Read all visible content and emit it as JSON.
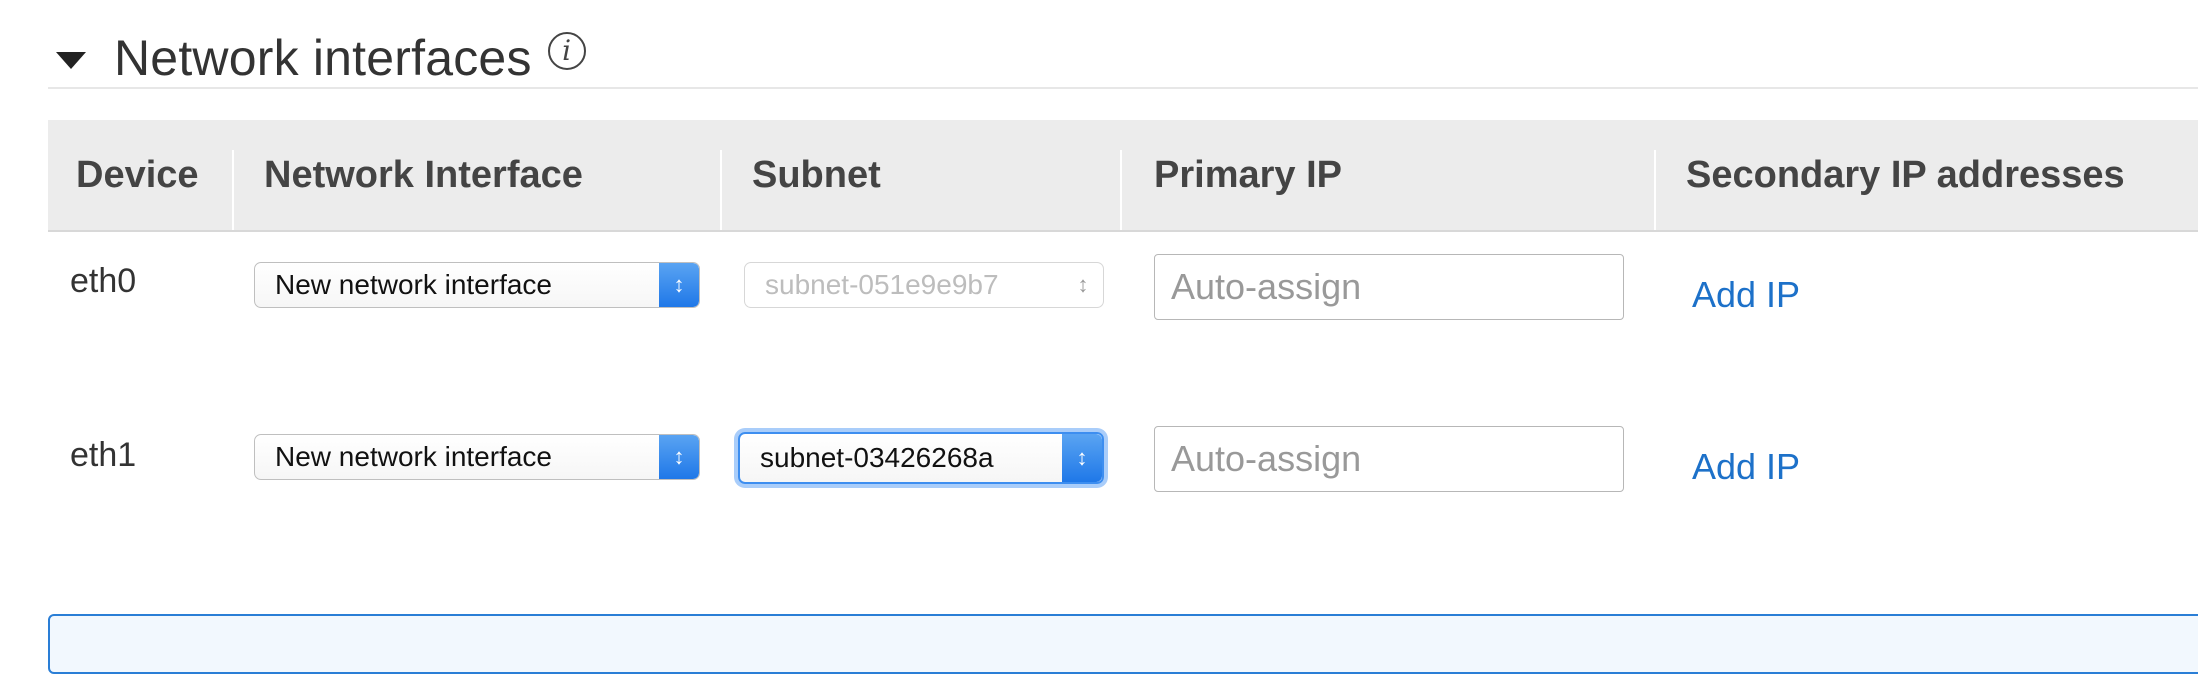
{
  "section": {
    "title": "Network interfaces",
    "info_glyph": "i",
    "toggle_icon": "caret-down-icon"
  },
  "table": {
    "columns": [
      "Device",
      "Network Interface",
      "Subnet",
      "Primary IP",
      "Secondary IP addresses"
    ],
    "rows": [
      {
        "device": "eth0",
        "network_interface": "New network interface",
        "subnet": "subnet-051e9e9b7",
        "subnet_state": "disabled",
        "primary_ip_placeholder": "Auto-assign",
        "secondary_action": "Add IP"
      },
      {
        "device": "eth1",
        "network_interface": "New network interface",
        "subnet": "subnet-03426268a",
        "subnet_state": "focused",
        "primary_ip_placeholder": "Auto-assign",
        "secondary_action": "Add IP"
      }
    ]
  },
  "icons": {
    "select_arrows": "up-down-chevron-icon",
    "info": "info-circle-icon"
  },
  "colors": {
    "link": "#1d71c9",
    "select_accent": "#1f78e8",
    "header_bg": "#ececec",
    "info_box_border": "#2a7ed6"
  }
}
